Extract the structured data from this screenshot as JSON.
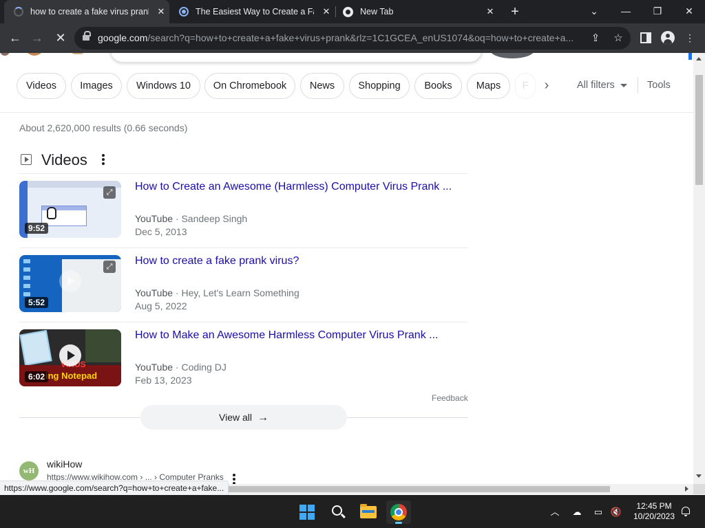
{
  "browser": {
    "tabs": [
      {
        "title": "how to create a fake virus prank",
        "favicon": "loading-spinner-icon",
        "active": true
      },
      {
        "title": "The Easiest Way to Create a Fake",
        "favicon": "site-globe-icon",
        "active": false
      },
      {
        "title": "New Tab",
        "favicon": "chrome-icon",
        "active": false
      }
    ],
    "address": {
      "host": "google.com",
      "path": "/search?q=how+to+create+a+fake+virus+prank&rlz=1C1GCEA_enUS1074&oq=how+to+create+a..."
    },
    "status_url": "https://www.google.com/search?q=how+to+create+a+fake..."
  },
  "search": {
    "chips": [
      "Videos",
      "Images",
      "Windows 10",
      "On Chromebook",
      "News",
      "Shopping",
      "Books",
      "Maps",
      "F"
    ],
    "all_filters": "All filters",
    "tools": "Tools",
    "stats": "About 2,620,000 results (0.66 seconds)"
  },
  "videos": {
    "heading": "Videos",
    "items": [
      {
        "title": "How to Create an Awesome (Harmless) Computer Virus Prank ...",
        "source": "YouTube",
        "channel": "Sandeep Singh",
        "date": "Dec 5, 2013",
        "duration": "9:52"
      },
      {
        "title": "How to create a fake prank virus?",
        "source": "YouTube",
        "channel": "Hey, Let's Learn Something",
        "date": "Aug 5, 2022",
        "duration": "5:52"
      },
      {
        "title": "How to Make an Awesome Harmless Computer Virus Prank ...",
        "source": "YouTube",
        "channel": "Coding DJ",
        "date": "Feb 13, 2023",
        "duration": "6:02",
        "thumb_text_top": "VIRUS",
        "thumb_text_bottom": "ing Notepad"
      }
    ],
    "feedback": "Feedback",
    "view_all": "View all"
  },
  "result": {
    "site_name": "wikiHow",
    "site_logo_text": "wH",
    "cite": "https://www.wikihow.com › ... › Computer Pranks"
  },
  "taskbar": {
    "time": "12:45 PM",
    "date": "10/20/2023"
  },
  "colors": {
    "link": "#1a0dab",
    "chrome_frame": "#202124",
    "toolbar": "#35363a",
    "taskbar": "#202020"
  }
}
